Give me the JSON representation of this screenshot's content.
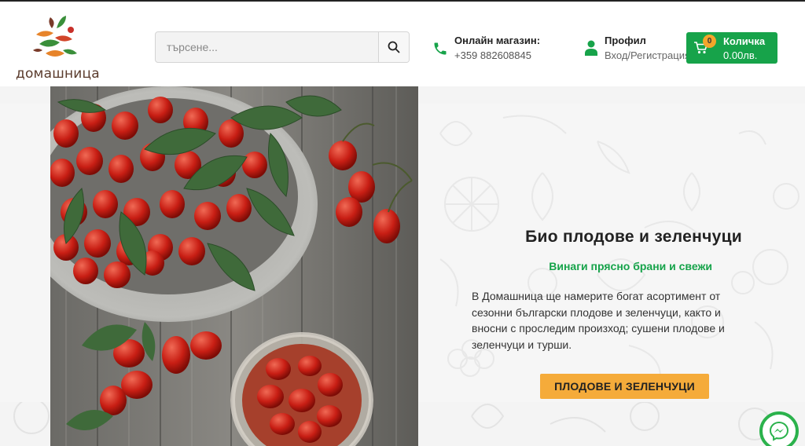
{
  "brand": {
    "logo_text": "домашница"
  },
  "search": {
    "placeholder": "търсене..."
  },
  "contact": {
    "label": "Онлайн магазин:",
    "phone": "+359 882608845"
  },
  "profile": {
    "label": "Профил",
    "links": "Вход/Регистрация"
  },
  "cart": {
    "label": "Количка",
    "count": "0",
    "total": "0.00лв."
  },
  "hero": {
    "title": "Био плодове и зеленчуци",
    "subtitle": "Винаги прясно брани и свежи",
    "text": "В Домашница ще намерите богат асортимент от сезонни български плодове и зеленчуци, както и вносни с проследим произход; сушени плодове и зеленчуци и турши.",
    "button": "ПЛОДОВЕ И ЗЕЛЕНЧУЦИ"
  },
  "colors": {
    "brand_green": "#17a34a",
    "accent_orange": "#f5ab3a"
  },
  "icons": [
    "search-icon",
    "phone-icon",
    "user-icon",
    "cart-icon",
    "messenger-icon"
  ]
}
